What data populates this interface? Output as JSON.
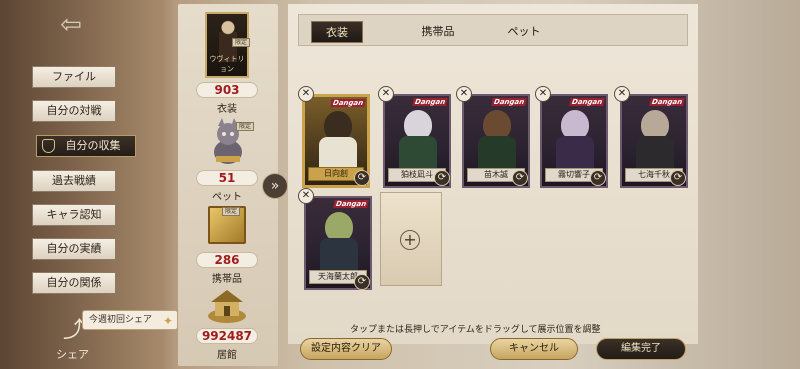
{
  "sidebar": {
    "nav": [
      {
        "label": "ファイル",
        "name": "nav-file"
      },
      {
        "label": "自分の対戦",
        "name": "nav-my-battles"
      },
      {
        "label": "自分の収集",
        "name": "nav-my-collection"
      },
      {
        "label": "過去戦績",
        "name": "nav-past-records"
      },
      {
        "label": "キャラ認知",
        "name": "nav-character-recognition"
      },
      {
        "label": "自分の実績",
        "name": "nav-my-achievements"
      },
      {
        "label": "自分の関係",
        "name": "nav-my-relations"
      }
    ],
    "active_index": 2,
    "share_tag": "今週初回シェア",
    "share_label": "シェア"
  },
  "stats": {
    "featured_portrait_name": "ウヴィトリョン",
    "limited_badge": "限定",
    "costume": {
      "count": "903",
      "label": "衣装"
    },
    "pet": {
      "count": "51",
      "label": "ペット"
    },
    "item": {
      "count": "286",
      "label": "携帯品"
    },
    "house": {
      "count": "992487",
      "label": "居館"
    }
  },
  "tabs": [
    "衣装",
    "携帯品",
    "ペット"
  ],
  "active_tab": 0,
  "logo_text": "Dangan",
  "cards": [
    {
      "name": "日向創",
      "selected": true
    },
    {
      "name": "狛枝凪斗",
      "selected": false
    },
    {
      "name": "苗木誠",
      "selected": false
    },
    {
      "name": "霧切響子",
      "selected": false
    },
    {
      "name": "七海千秋",
      "selected": false
    },
    {
      "name": "天海蘭太郎",
      "selected": false
    }
  ],
  "hint": "タップまたは長押しでアイテムをドラッグして展示位置を調整",
  "buttons": {
    "reset": "設定内容クリア",
    "cancel": "キャンセル",
    "done": "編集完了"
  },
  "colors": {
    "accent_gold": "#c9a24a",
    "count_red": "#a11d1d"
  }
}
